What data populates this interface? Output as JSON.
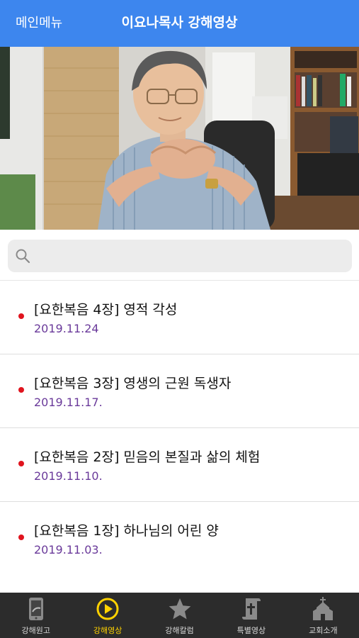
{
  "header": {
    "menu_label": "메인메뉴",
    "title": "이요나목사 강해영상"
  },
  "search": {
    "placeholder": ""
  },
  "videos": [
    {
      "title": "[요한복음 4장] 영적 각성",
      "date": "2019.11.24"
    },
    {
      "title": "[요한복음 3장] 영생의 근원 독생자",
      "date": "2019.11.17."
    },
    {
      "title": "[요한복음 2장] 믿음의 본질과 삶의 체험",
      "date": "2019.11.10."
    },
    {
      "title": "[요한복음 1장] 하나님의 어린 양",
      "date": "2019.11.03."
    }
  ],
  "tabs": [
    {
      "label": "강해원고",
      "icon": "phone-manuscript-icon"
    },
    {
      "label": "강해영상",
      "icon": "play-circle-icon",
      "active": true
    },
    {
      "label": "강해칼럼",
      "icon": "star-icon"
    },
    {
      "label": "특별영상",
      "icon": "scroll-cross-icon"
    },
    {
      "label": "교회소개",
      "icon": "church-icon"
    }
  ],
  "colors": {
    "header_bg": "#3d86ee",
    "bullet": "#e0141e",
    "date_text": "#6a3a9a",
    "tab_active": "#ffd200",
    "tabbar_bg": "#2c2c2c"
  }
}
